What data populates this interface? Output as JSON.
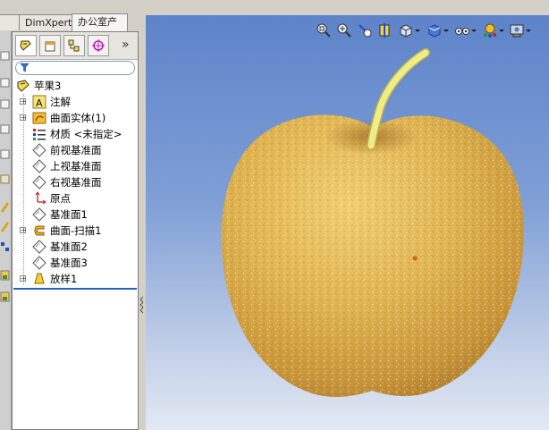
{
  "command_tabs": {
    "partial_tab": "",
    "dimxpert": "DimXpert",
    "office_products": "办公室产品"
  },
  "feature_manager": {
    "more_label": "»",
    "tabs": [
      {
        "name": "feature-tree"
      },
      {
        "name": "property-manager"
      },
      {
        "name": "configuration-manager"
      },
      {
        "name": "dimxpert-manager"
      }
    ],
    "tree": [
      {
        "label": "苹果3",
        "icon": "part-icon",
        "expandable": false,
        "level": 0
      },
      {
        "label": "注解",
        "icon": "annotations-icon",
        "expandable": true,
        "level": 1
      },
      {
        "label": "曲面实体(1)",
        "icon": "surface-bodies-icon",
        "expandable": true,
        "level": 1
      },
      {
        "label": "材质 <未指定>",
        "icon": "material-icon",
        "expandable": false,
        "level": 1
      },
      {
        "label": "前视基准面",
        "icon": "plane-icon",
        "expandable": false,
        "level": 1
      },
      {
        "label": "上视基准面",
        "icon": "plane-icon",
        "expandable": false,
        "level": 1
      },
      {
        "label": "右视基准面",
        "icon": "plane-icon",
        "expandable": false,
        "level": 1
      },
      {
        "label": "原点",
        "icon": "origin-icon",
        "expandable": false,
        "level": 1
      },
      {
        "label": "基准面1",
        "icon": "plane-icon",
        "expandable": false,
        "level": 1
      },
      {
        "label": "曲面-扫描1",
        "icon": "surface-sweep-icon",
        "expandable": true,
        "level": 1
      },
      {
        "label": "基准面2",
        "icon": "plane-icon",
        "expandable": false,
        "level": 1
      },
      {
        "label": "基准面3",
        "icon": "plane-icon",
        "expandable": false,
        "level": 1
      },
      {
        "label": "放样1",
        "icon": "loft-icon",
        "expandable": true,
        "level": 1
      }
    ]
  },
  "view_toolbar": [
    {
      "name": "zoom-to-fit-icon"
    },
    {
      "name": "zoom-to-area-icon"
    },
    {
      "name": "previous-view-icon"
    },
    {
      "name": "section-view-icon"
    },
    {
      "name": "view-orientation-icon"
    },
    {
      "name": "display-style-icon"
    },
    {
      "name": "hide-show-items-icon"
    },
    {
      "name": "edit-appearance-icon"
    },
    {
      "name": "apply-scene-icon"
    }
  ],
  "colors": {
    "viewport_top": "#5e83c9",
    "viewport_bottom": "#e3e9f4",
    "apple_body": "#e0b552",
    "apple_stem": "#f0ec8a"
  }
}
